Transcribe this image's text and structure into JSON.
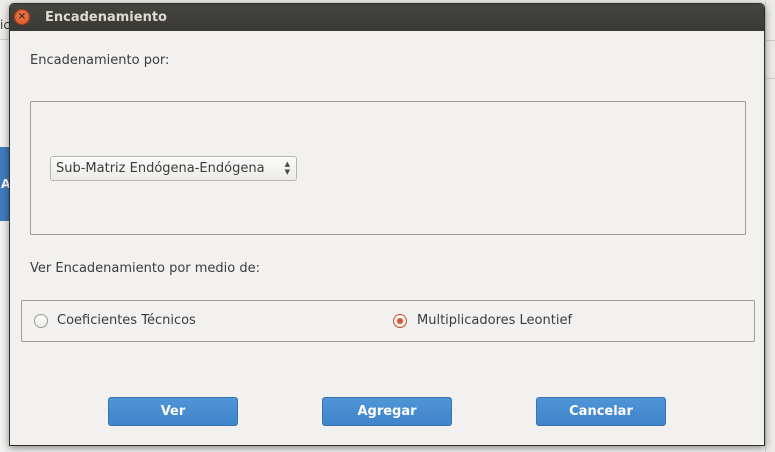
{
  "background": {
    "partial_text": "ic",
    "partial_button_letter": "A"
  },
  "dialog": {
    "title": "Encadenamiento",
    "close_glyph": "×"
  },
  "encadenamiento": {
    "label": "Encadenamiento por:",
    "selected_option": "Sub-Matriz Endógena-Endógena"
  },
  "ver": {
    "label": "Ver Encadenamiento por medio de:",
    "options": [
      {
        "label": "Coeficientes Técnicos",
        "checked": false
      },
      {
        "label": "Multiplicadores Leontief",
        "checked": true
      }
    ]
  },
  "buttons": {
    "ver": "Ver",
    "agregar": "Agregar",
    "cancelar": "Cancelar"
  },
  "colors": {
    "accent_button": "#4189cc",
    "radio_selected": "#d9532c",
    "titlebar": "#3c3b37"
  }
}
